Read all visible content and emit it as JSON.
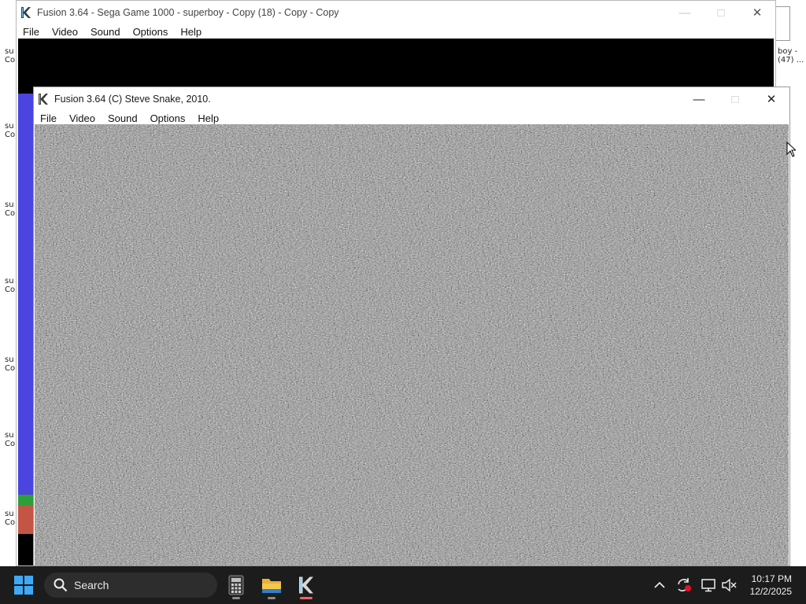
{
  "back_window": {
    "title": "Fusion 3.64 - Sega Game 1000 - superboy - Copy (18) - Copy - Copy",
    "menu": [
      "File",
      "Video",
      "Sound",
      "Options",
      "Help"
    ]
  },
  "front_window": {
    "title": "Fusion 3.64 (C) Steve Snake, 2010.",
    "menu": [
      "File",
      "Video",
      "Sound",
      "Options",
      "Help"
    ]
  },
  "desktop": {
    "left_labels": [
      "su",
      "Co",
      "su",
      "Co",
      "su",
      "Co",
      "su",
      "Co",
      "su",
      "Co",
      "su",
      "Co",
      "su",
      "Co"
    ],
    "right_labels": [
      "boy -",
      "(47) ..."
    ]
  },
  "taskbar": {
    "search_label": "Search",
    "apps": [
      "calculator-icon",
      "file-explorer-icon",
      "fusion-emulator-icon"
    ],
    "time": "10:17 PM",
    "date": "12/2/2025"
  }
}
